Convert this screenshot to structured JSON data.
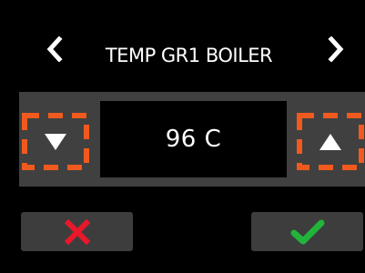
{
  "header": {
    "title": "TEMP GR1 BOILER",
    "prev_icon": "chevron-left-icon",
    "next_icon": "chevron-right-icon"
  },
  "setting": {
    "value": "96 C",
    "decrease_icon": "triangle-down-icon",
    "increase_icon": "triangle-up-icon"
  },
  "actions": {
    "cancel_icon": "x-icon",
    "confirm_icon": "checkmark-icon"
  },
  "colors": {
    "background": "#000000",
    "panel": "#404040",
    "button": "#3d3d3d",
    "focus_dash": "#f05a1e",
    "cancel": "#e8182a",
    "confirm": "#22b43a",
    "text": "#ffffff"
  }
}
